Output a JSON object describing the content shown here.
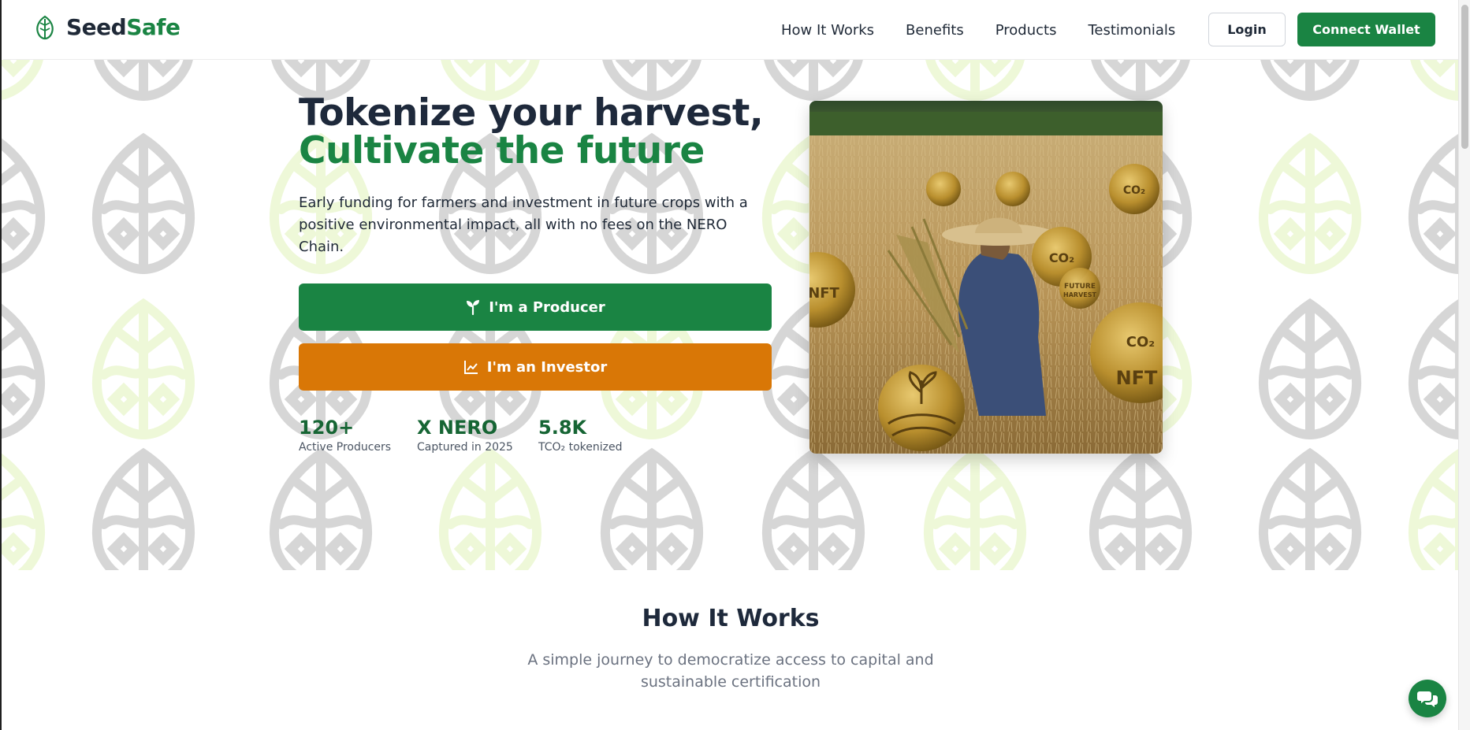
{
  "brand": {
    "part1": "Seed",
    "part2": "Safe",
    "icon": "leaf-icon",
    "color": "#1a8443"
  },
  "nav": {
    "items": [
      {
        "label": "How It Works"
      },
      {
        "label": "Benefits"
      },
      {
        "label": "Products"
      },
      {
        "label": "Testimonials"
      }
    ],
    "login": "Login",
    "connect_wallet": "Connect Wallet"
  },
  "hero": {
    "title_line1": "Tokenize your harvest,",
    "title_line2": "Cultivate the future",
    "description": "Early funding for farmers and investment in future crops with a positive environmental impact, all with no fees on the NERO Chain.",
    "producer_button": "I'm a Producer",
    "producer_icon": "sprout-icon",
    "investor_button": "I'm an Investor",
    "investor_icon": "chart-line-icon",
    "stats": [
      {
        "value": "120+",
        "label": "Active Producers"
      },
      {
        "value": "X NERO",
        "label": "Captured in 2025"
      },
      {
        "value": "5.8K",
        "label": "TCO₂ tokenized"
      }
    ],
    "image_coins": [
      "CO2",
      "CO2",
      "CO2",
      "FUTURE HARVEST",
      "NFT",
      "NFT"
    ]
  },
  "how_it_works": {
    "title": "How It Works",
    "subtitle": "A simple journey to democratize access to capital and sustainable certification"
  },
  "chat": {
    "icon": "chat-icon"
  },
  "colors": {
    "primary": "#1a8443",
    "accent": "#d97706",
    "text": "#1e293b"
  }
}
